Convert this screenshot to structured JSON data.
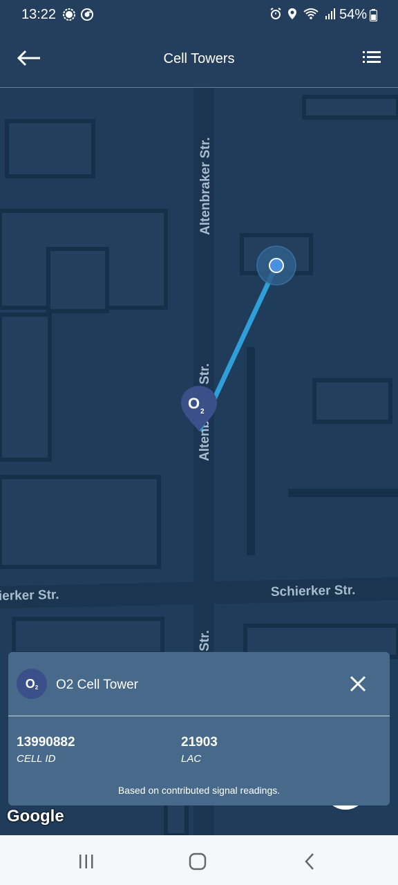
{
  "status_bar": {
    "time": "13:22",
    "battery": "54%",
    "icons_left": [
      "signal-messenger-icon",
      "chrome-icon"
    ],
    "icons_right": [
      "alarm-icon",
      "location-icon",
      "wifi-icon",
      "cell-signal-icon"
    ]
  },
  "app_bar": {
    "title": "Cell Towers",
    "back_icon": "arrow-left-icon",
    "menu_icon": "list-icon"
  },
  "map": {
    "streets": {
      "altenbraker_top": "Altenbraker Str.",
      "altenbraker_mid": "Altenbraker Str.",
      "altenbraker_bottom": "Str.",
      "schierker_left": "ierker Str.",
      "schierker_right": "Schierker Str."
    },
    "attribution": "Google",
    "colors": {
      "background": "#1f3c5a",
      "road": "#1b3450",
      "link_line": "#2e9fd8",
      "user_dot": "#4a90e2",
      "marker": "#3b5088"
    }
  },
  "tower_card": {
    "title": "O2 Cell Tower",
    "avatar_text": "O",
    "avatar_sub": "2",
    "cell_id_value": "13990882",
    "cell_id_label": "CELL ID",
    "lac_value": "21903",
    "lac_label": "LAC",
    "note": "Based on contributed signal readings."
  },
  "nav_bar": {
    "recents": "recents-icon",
    "home": "home-icon",
    "back": "back-icon"
  }
}
